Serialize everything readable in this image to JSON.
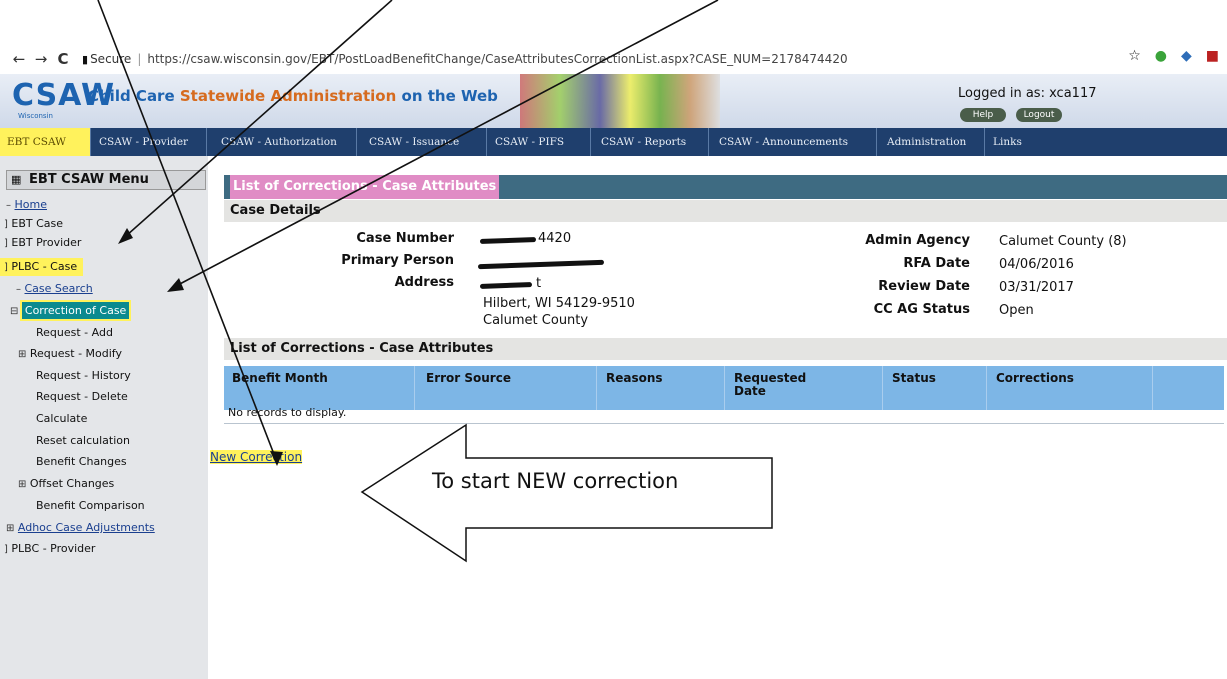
{
  "browser": {
    "back_icon": "←",
    "forward_icon": "→",
    "reload_icon": "C",
    "secure_label": "Secure",
    "url": "https://csaw.wisconsin.gov/EBT/PostLoadBenefitChange/CaseAttributesCorrectionList.aspx?CASE_NUM=2178474420"
  },
  "header": {
    "logo": "CSAW",
    "logo_sub": "Wisconsin",
    "tagline_part1": "Child Care ",
    "tagline_part2": "Statewide ",
    "tagline_part3": "Administration",
    "tagline_part4": " on the Web",
    "logged_in_label": "Logged in as: xca117",
    "help_label": "Help",
    "logout_label": "Logout"
  },
  "mainnav": [
    "EBT CSAW",
    "CSAW - Provider",
    "CSAW - Authorization",
    "CSAW - Issuance",
    "CSAW - PIFS",
    "CSAW - Reports",
    "CSAW - Announcements",
    "Administration",
    "Links"
  ],
  "sidebar": {
    "menu_title": "EBT CSAW Menu",
    "items": [
      {
        "label": "Home"
      },
      {
        "label": "EBT Case"
      },
      {
        "label": "EBT Provider"
      },
      {
        "label": "PLBC - Case"
      },
      {
        "label": "Case Search"
      },
      {
        "label": "Correction of Case"
      },
      {
        "label": "Request - Add"
      },
      {
        "label": "Request - Modify"
      },
      {
        "label": "Request - History"
      },
      {
        "label": "Request - Delete"
      },
      {
        "label": "Calculate"
      },
      {
        "label": "Reset calculation"
      },
      {
        "label": "Benefit Changes"
      },
      {
        "label": "Offset Changes"
      },
      {
        "label": "Benefit Comparison"
      },
      {
        "label": "Adhoc Case Adjustments"
      },
      {
        "label": "PLBC - Provider"
      }
    ]
  },
  "page": {
    "title": "List of Corrections - Case Attributes",
    "case_details_title": "Case Details",
    "case_number_label": "Case Number",
    "case_number_visible": "4420",
    "primary_person_label": "Primary Person",
    "address_label": "Address",
    "address_line1_tail": "t",
    "address_line2": "Hilbert, WI 54129-9510",
    "address_line3": "Calumet County",
    "admin_agency_label": "Admin Agency",
    "admin_agency_value": "Calumet County (8)",
    "rfa_date_label": "RFA Date",
    "rfa_date_value": "04/06/2016",
    "review_date_label": "Review Date",
    "review_date_value": "03/31/2017",
    "cc_ag_status_label": "CC AG Status",
    "cc_ag_status_value": "Open",
    "corrections_title": "List of Corrections - Case Attributes",
    "columns": [
      "Benefit Month",
      "Error Source",
      "Reasons",
      "Requested Date",
      "Status",
      "Corrections"
    ],
    "empty_message": "No records to display.",
    "new_correction_link": "New Correction"
  },
  "annotation": {
    "callout_text": "To start NEW correction"
  },
  "colors": {
    "highlight_yellow": "#fff25c",
    "highlight_pink": "#e08cc5",
    "highlight_teal": "#0b8a8f",
    "nav_bar": "#1f3f6d",
    "grid_header": "#7db6e6"
  }
}
